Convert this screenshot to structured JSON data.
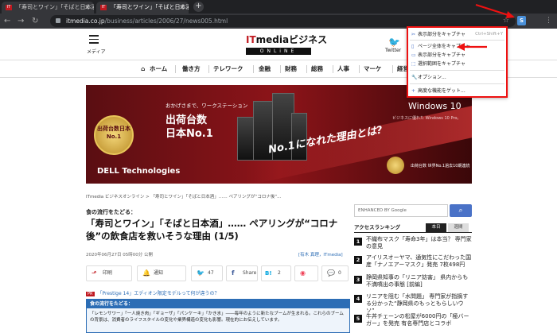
{
  "browser": {
    "tabs": [
      {
        "title": "「寿司とワイン」「そばと日本酒」...."
      },
      {
        "title": "「寿司とワイン」「そばと日本酒」...."
      }
    ],
    "new_tab_glyph": "+",
    "url_host": "itmedia.co.jp",
    "url_path": "/business/articles/2006/27/news005.html",
    "extension_letter": "S"
  },
  "header": {
    "menu_label": "メディア",
    "logo_main": "ITmediaビジネス",
    "logo_it": "IT",
    "logo_rest": "mediaビジネス",
    "logo_sub": "ONLiNE",
    "twitter_label": "Twitter"
  },
  "gnav": {
    "items": [
      "ホーム",
      "働き方",
      "テレワーク",
      "金融",
      "財務",
      "総務",
      "人事",
      "マーケ",
      "経営"
    ]
  },
  "banner": {
    "medal_text": "出荷台数日本No.1",
    "sub": "おかげさまで、ワークステーション",
    "main_line1": "出荷台数",
    "main_line2": "日本No.1",
    "slogan": "No.1になれた理由とは?",
    "brand": "DELL Technologies",
    "win": "Windows 10",
    "win_sub": "ビジネスに優れた Windows 10 Pro。",
    "foot": "出荷台数 世界No.1過去10期連続"
  },
  "popup": {
    "items": [
      {
        "label": "表示部分をキャプチャ",
        "shortcut": "Ctrl+Shift+Y"
      },
      {
        "label": "ページ全体をキャプチャ",
        "shortcut": ""
      },
      {
        "label": "表示部分をキャプチャ",
        "shortcut": ""
      },
      {
        "label": "選択範囲をキャプチャ",
        "shortcut": ""
      },
      {
        "label": "オプション...",
        "shortcut": ""
      },
      {
        "label": "高度な機能をゲット...",
        "shortcut": ""
      }
    ]
  },
  "article": {
    "breadcrumb": "ITmedia ビジネスオンライン > 「寿司とワイン」「そばと日本酒」…… ペアリングが“コロナ後”...",
    "kicker": "食の流行をたどる：",
    "title": "「寿司とワイン」「そばと日本酒」…… ペアリングが“コロナ後”の飲食店を救いそうな理由 (1/5)",
    "date": "2020年06月27日 05時00分 公開",
    "author": "[有木 真理，ITmedia]",
    "social": [
      {
        "label": "印刷",
        "icon": "⬏"
      },
      {
        "label": "通知",
        "icon": "🔔"
      },
      {
        "label": "47",
        "icon": "🐦"
      },
      {
        "label": "Share",
        "icon": "f"
      },
      {
        "label": "2",
        "icon": "B!"
      },
      {
        "label": "",
        "icon": "◉"
      },
      {
        "label": "0",
        "icon": "💬"
      }
    ],
    "ad_pr": "PR",
    "ad_text": "「Prestige 14」エディオン限定モデルって何が違うの？",
    "summary_head": "食の流行をたどる：",
    "summary_body": "「レモンサワー」「一人焼き肉」「ギョーザ」「パンケーキ」「かき氷」――毎年のように新たなブームが生まれる。これらのブームの背景は、消費者のライフスタイルの変化や業界構造の変化も影響。現在的にお伝えしています。"
  },
  "sidebar": {
    "search_placeholder": "ENHANCED BY Google",
    "ranking_title": "アクセスランキング",
    "tab_today": "本日",
    "tab_week": "週間",
    "ranking": [
      {
        "num": "1",
        "text": "不織布マスク「寿命3年」は本当？ 専門家の意見"
      },
      {
        "num": "2",
        "text": "アイリスオーヤマ、通気性にこだわった国産「ナノエアーマスク」発売 7枚498円"
      },
      {
        "num": "3",
        "text": "静岡県知事の「リニア妨害」 県内からも不満噴出の事態 [前編]"
      },
      {
        "num": "4",
        "text": "リニアを阻む「水問題」 専門家が指摘する分かった“静岡県のもっともらしいウソ”"
      },
      {
        "num": "5",
        "text": "牛丼チェーンの松屋が6000円の「極バーガー」を発売 有名専門店とコラボ"
      }
    ]
  }
}
